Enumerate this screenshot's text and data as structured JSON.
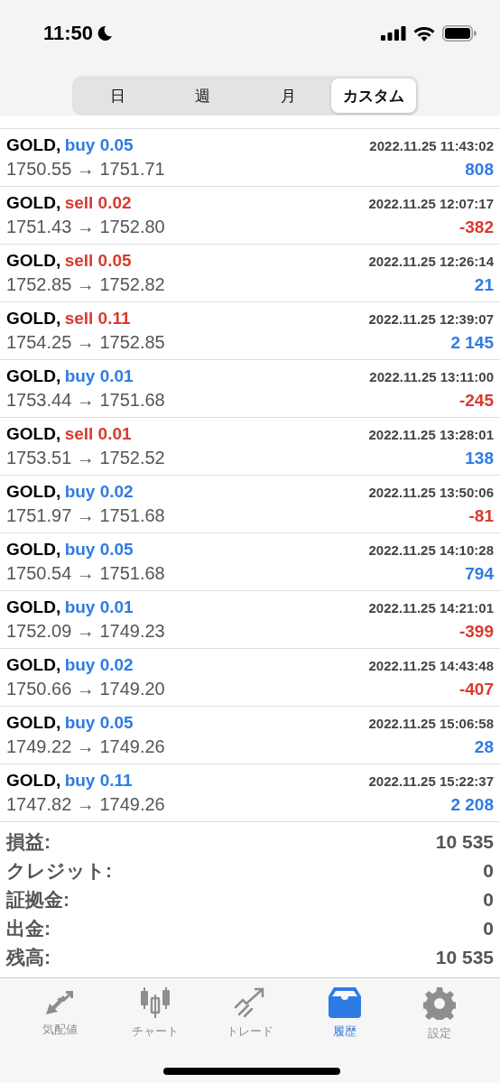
{
  "status_bar": {
    "time": "11:50",
    "do_not_disturb": true
  },
  "period_tabs": [
    {
      "label": "日",
      "selected": false
    },
    {
      "label": "週",
      "selected": false
    },
    {
      "label": "月",
      "selected": false
    },
    {
      "label": "カスタム",
      "selected": true
    }
  ],
  "deals": [
    {
      "symbol": "GOLD,",
      "volume": {
        "text": "buy 0.05",
        "color": "#2f7be6"
      },
      "time": "2022.11.25 11:43:02",
      "prices": "1750.55 → 1751.71",
      "profit": {
        "text": "808",
        "color": "#2f7be6"
      }
    },
    {
      "symbol": "GOLD,",
      "volume": {
        "text": "sell 0.02",
        "color": "#d83a2e"
      },
      "time": "2022.11.25 12:07:17",
      "prices": "1751.43 → 1752.80",
      "profit": {
        "text": "-382",
        "color": "#d83a2e"
      }
    },
    {
      "symbol": "GOLD,",
      "volume": {
        "text": "sell 0.05",
        "color": "#d83a2e"
      },
      "time": "2022.11.25 12:26:14",
      "prices": "1752.85 → 1752.82",
      "profit": {
        "text": "21",
        "color": "#2f7be6"
      }
    },
    {
      "symbol": "GOLD,",
      "volume": {
        "text": "sell 0.11",
        "color": "#d83a2e"
      },
      "time": "2022.11.25 12:39:07",
      "prices": "1754.25 → 1752.85",
      "profit": {
        "text": "2 145",
        "color": "#2f7be6"
      }
    },
    {
      "symbol": "GOLD,",
      "volume": {
        "text": "buy 0.01",
        "color": "#2f7be6"
      },
      "time": "2022.11.25 13:11:00",
      "prices": "1753.44 → 1751.68",
      "profit": {
        "text": "-245",
        "color": "#d83a2e"
      }
    },
    {
      "symbol": "GOLD,",
      "volume": {
        "text": "sell 0.01",
        "color": "#d83a2e"
      },
      "time": "2022.11.25 13:28:01",
      "prices": "1753.51 → 1752.52",
      "profit": {
        "text": "138",
        "color": "#2f7be6"
      }
    },
    {
      "symbol": "GOLD,",
      "volume": {
        "text": "buy 0.02",
        "color": "#2f7be6"
      },
      "time": "2022.11.25 13:50:06",
      "prices": "1751.97 → 1751.68",
      "profit": {
        "text": "-81",
        "color": "#d83a2e"
      }
    },
    {
      "symbol": "GOLD,",
      "volume": {
        "text": "buy 0.05",
        "color": "#2f7be6"
      },
      "time": "2022.11.25 14:10:28",
      "prices": "1750.54 → 1751.68",
      "profit": {
        "text": "794",
        "color": "#2f7be6"
      }
    },
    {
      "symbol": "GOLD,",
      "volume": {
        "text": "buy 0.01",
        "color": "#2f7be6"
      },
      "time": "2022.11.25 14:21:01",
      "prices": "1752.09 → 1749.23",
      "profit": {
        "text": "-399",
        "color": "#d83a2e"
      }
    },
    {
      "symbol": "GOLD,",
      "volume": {
        "text": "buy 0.02",
        "color": "#2f7be6"
      },
      "time": "2022.11.25 14:43:48",
      "prices": "1750.66 → 1749.20",
      "profit": {
        "text": "-407",
        "color": "#d83a2e"
      }
    },
    {
      "symbol": "GOLD,",
      "volume": {
        "text": "buy 0.05",
        "color": "#2f7be6"
      },
      "time": "2022.11.25 15:06:58",
      "prices": "1749.22 → 1749.26",
      "profit": {
        "text": "28",
        "color": "#2f7be6"
      }
    },
    {
      "symbol": "GOLD,",
      "volume": {
        "text": "buy 0.11",
        "color": "#2f7be6"
      },
      "time": "2022.11.25 15:22:37",
      "prices": "1747.82 → 1749.26",
      "profit": {
        "text": "2 208",
        "color": "#2f7be6"
      }
    }
  ],
  "summary": [
    {
      "label": "損益:",
      "value": "10 535"
    },
    {
      "label": "クレジット:",
      "value": "0"
    },
    {
      "label": "証拠金:",
      "value": "0"
    },
    {
      "label": "出金:",
      "value": "0"
    },
    {
      "label": "残高:",
      "value": "10 535"
    }
  ],
  "tab_bar": [
    {
      "kind": "quotes",
      "label": "気配値",
      "selected": false
    },
    {
      "kind": "chart",
      "label": "チャート",
      "selected": false
    },
    {
      "kind": "trade",
      "label": "トレード",
      "selected": false
    },
    {
      "kind": "history",
      "label": "履歴",
      "selected": true
    },
    {
      "kind": "settings",
      "label": "設定",
      "selected": false
    }
  ]
}
